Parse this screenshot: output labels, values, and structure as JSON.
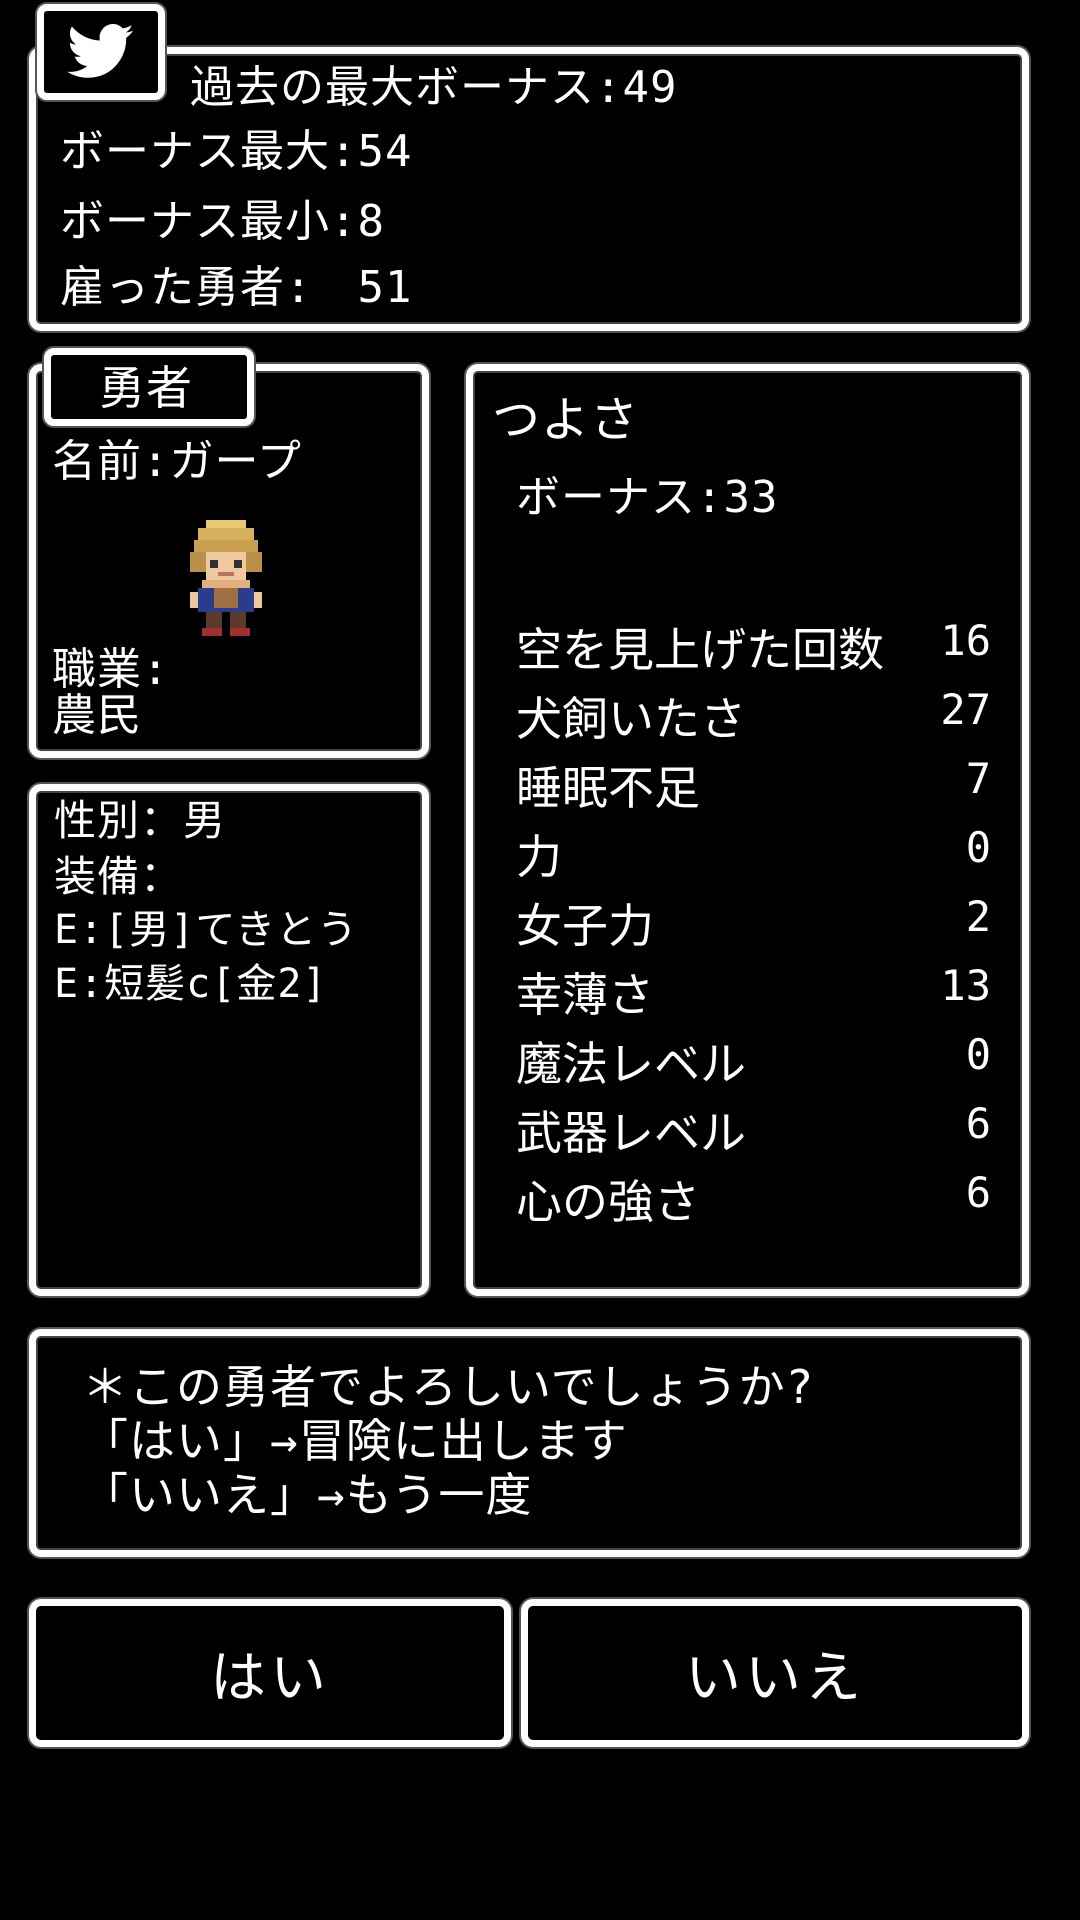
{
  "top": {
    "past_max_bonus": "過去の最大ボーナス:49",
    "bonus_max": "ボーナス最大:54",
    "bonus_min": "ボーナス最小:8",
    "hired_heroes": "雇った勇者:　51"
  },
  "twitter": {
    "icon": "twitter-bird-icon",
    "color": "#ffffff"
  },
  "hero": {
    "tab": "勇者",
    "name": "名前:ガープ",
    "job_label": "職業:",
    "job_value": "農民"
  },
  "equip": {
    "gender": "性別：男",
    "equip_label": "装備：",
    "item1": "E:[男]てきとう",
    "item2": "E:短髪c[金2]"
  },
  "stats": {
    "title": "つよさ",
    "bonus": "ボーナス:33",
    "rows": [
      {
        "name": "空を見上げた回数",
        "value": "16"
      },
      {
        "name": "犬飼いたさ",
        "value": "27"
      },
      {
        "name": "睡眠不足",
        "value": "7"
      },
      {
        "name": "力",
        "value": "0"
      },
      {
        "name": "女子力",
        "value": "2"
      },
      {
        "name": "幸薄さ",
        "value": "13"
      },
      {
        "name": "魔法レベル",
        "value": "0"
      },
      {
        "name": "武器レベル",
        "value": "6"
      },
      {
        "name": "心の強さ",
        "value": "6"
      }
    ]
  },
  "message": {
    "line1": "＊この勇者でよろしいでしょうか?",
    "line2": "「はい」→冒険に出します",
    "line3": "「いいえ」→もう一度"
  },
  "buttons": {
    "yes": "はい",
    "no": "いいえ"
  }
}
